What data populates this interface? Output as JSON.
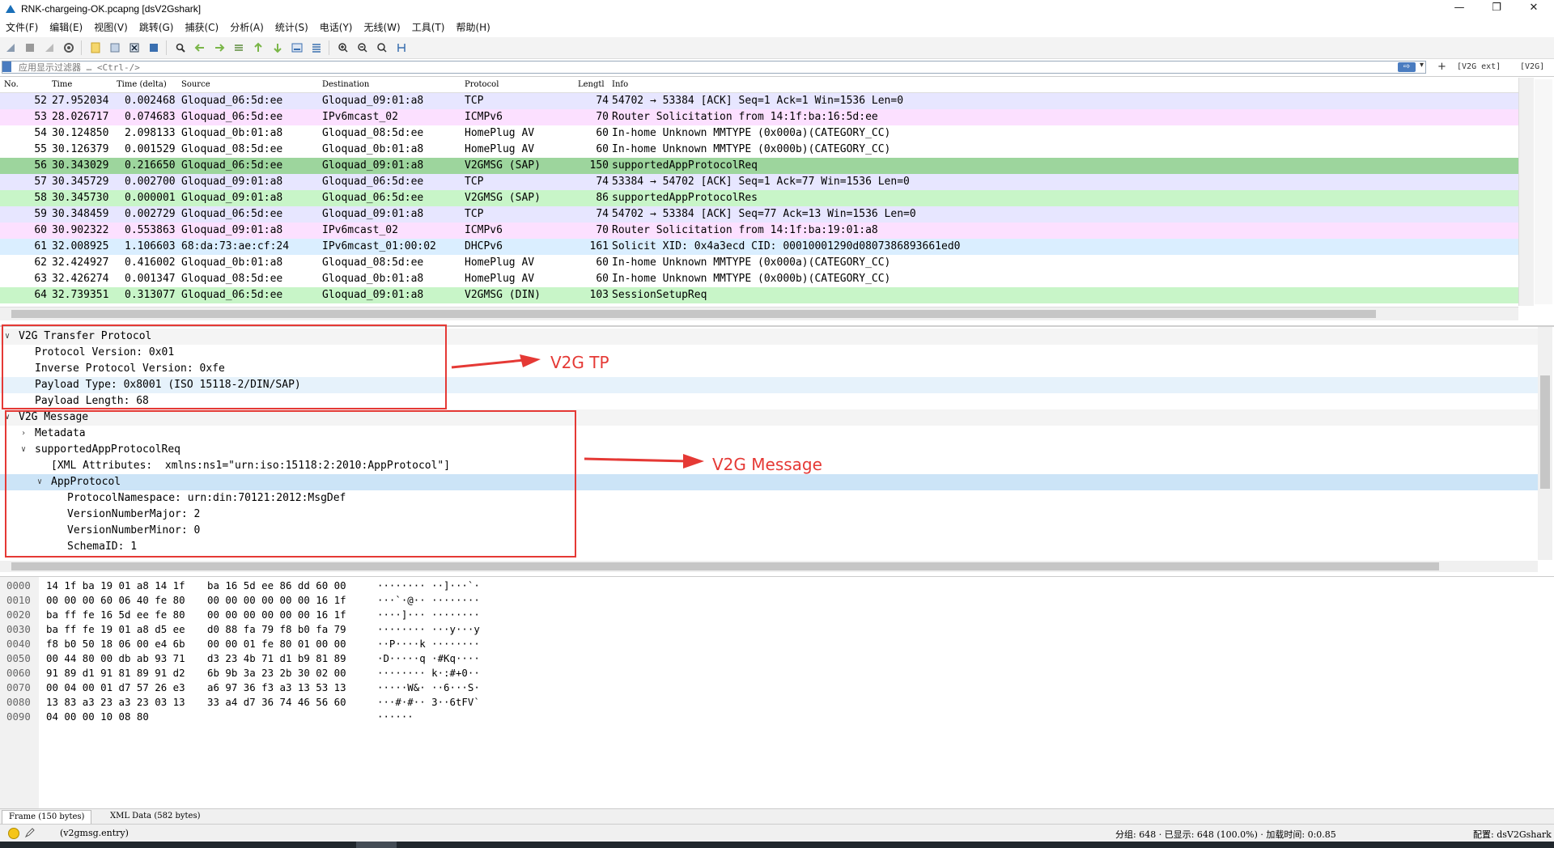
{
  "window": {
    "title": "RNK-chargeing-OK.pcapng [dsV2Gshark]",
    "controls": [
      "—",
      "❐",
      "✕"
    ]
  },
  "menu": [
    "文件(F)",
    "编辑(E)",
    "视图(V)",
    "跳转(G)",
    "捕获(C)",
    "分析(A)",
    "统计(S)",
    "电话(Y)",
    "无线(W)",
    "工具(T)",
    "帮助(H)"
  ],
  "filter": {
    "placeholder": "应用显示过滤器 … <Ctrl-/>",
    "buttons": [
      "V2G ext",
      "V2G"
    ]
  },
  "packet_list": {
    "columns": [
      "No.",
      "Time",
      "Time (delta)",
      "Source",
      "Destination",
      "Protocol",
      "Lengtl",
      "Info"
    ],
    "rows": [
      {
        "no": "52",
        "time": "27.952034",
        "delta": "0.002468",
        "src": "Gloquad_06:5d:ee",
        "dst": "Gloquad_09:01:a8",
        "proto": "TCP",
        "len": "74",
        "info": "54702 → 53384 [ACK] Seq=1 Ack=1 Win=1536 Len=0",
        "bg": "#e7e6ff"
      },
      {
        "no": "53",
        "time": "28.026717",
        "delta": "0.074683",
        "src": "Gloquad_06:5d:ee",
        "dst": "IPv6mcast_02",
        "proto": "ICMPv6",
        "len": "70",
        "info": "Router Solicitation from 14:1f:ba:16:5d:ee",
        "bg": "#fce0ff"
      },
      {
        "no": "54",
        "time": "30.124850",
        "delta": "2.098133",
        "src": "Gloquad_0b:01:a8",
        "dst": "Gloquad_08:5d:ee",
        "proto": "HomePlug AV",
        "len": "60",
        "info": "In-home Unknown MMTYPE (0x000a)(CATEGORY_CC)",
        "bg": "#ffffff"
      },
      {
        "no": "55",
        "time": "30.126379",
        "delta": "0.001529",
        "src": "Gloquad_08:5d:ee",
        "dst": "Gloquad_0b:01:a8",
        "proto": "HomePlug AV",
        "len": "60",
        "info": "In-home Unknown MMTYPE (0x000b)(CATEGORY_CC)",
        "bg": "#ffffff"
      },
      {
        "no": "56",
        "time": "30.343029",
        "delta": "0.216650",
        "src": "Gloquad_06:5d:ee",
        "dst": "Gloquad_09:01:a8",
        "proto": "V2GMSG (SAP)",
        "len": "150",
        "info": "supportedAppProtocolReq",
        "bg": "#9dd59d"
      },
      {
        "no": "57",
        "time": "30.345729",
        "delta": "0.002700",
        "src": "Gloquad_09:01:a8",
        "dst": "Gloquad_06:5d:ee",
        "proto": "TCP",
        "len": "74",
        "info": "53384 → 54702 [ACK] Seq=1 Ack=77 Win=1536 Len=0",
        "bg": "#e7e6ff"
      },
      {
        "no": "58",
        "time": "30.345730",
        "delta": "0.000001",
        "src": "Gloquad_09:01:a8",
        "dst": "Gloquad_06:5d:ee",
        "proto": "V2GMSG (SAP)",
        "len": "86",
        "info": "supportedAppProtocolRes",
        "bg": "#c8f5c8"
      },
      {
        "no": "59",
        "time": "30.348459",
        "delta": "0.002729",
        "src": "Gloquad_06:5d:ee",
        "dst": "Gloquad_09:01:a8",
        "proto": "TCP",
        "len": "74",
        "info": "54702 → 53384 [ACK] Seq=77 Ack=13 Win=1536 Len=0",
        "bg": "#e7e6ff"
      },
      {
        "no": "60",
        "time": "30.902322",
        "delta": "0.553863",
        "src": "Gloquad_09:01:a8",
        "dst": "IPv6mcast_02",
        "proto": "ICMPv6",
        "len": "70",
        "info": "Router Solicitation from 14:1f:ba:19:01:a8",
        "bg": "#fce0ff"
      },
      {
        "no": "61",
        "time": "32.008925",
        "delta": "1.106603",
        "src": "68:da:73:ae:cf:24",
        "dst": "IPv6mcast_01:00:02",
        "proto": "DHCPv6",
        "len": "161",
        "info": "Solicit XID: 0x4a3ecd CID: 00010001290d0807386893661ed0",
        "bg": "#daeeff"
      },
      {
        "no": "62",
        "time": "32.424927",
        "delta": "0.416002",
        "src": "Gloquad_0b:01:a8",
        "dst": "Gloquad_08:5d:ee",
        "proto": "HomePlug AV",
        "len": "60",
        "info": "In-home Unknown MMTYPE (0x000a)(CATEGORY_CC)",
        "bg": "#ffffff"
      },
      {
        "no": "63",
        "time": "32.426274",
        "delta": "0.001347",
        "src": "Gloquad_08:5d:ee",
        "dst": "Gloquad_0b:01:a8",
        "proto": "HomePlug AV",
        "len": "60",
        "info": "In-home Unknown MMTYPE (0x000b)(CATEGORY_CC)",
        "bg": "#ffffff"
      },
      {
        "no": "64",
        "time": "32.739351",
        "delta": "0.313077",
        "src": "Gloquad_06:5d:ee",
        "dst": "Gloquad_09:01:a8",
        "proto": "V2GMSG (DIN)",
        "len": "103",
        "info": "SessionSetupReq",
        "bg": "#c8f5c8"
      }
    ]
  },
  "detail_tree": [
    {
      "text": "V2G Transfer Protocol",
      "twisty": "open",
      "indent": 0,
      "bg": "#f4f4f4"
    },
    {
      "text": "Protocol Version: 0x01",
      "twisty": "",
      "indent": 2,
      "bg": "#ffffff"
    },
    {
      "text": "Inverse Protocol Version: 0xfe",
      "twisty": "",
      "indent": 2,
      "bg": "#ffffff"
    },
    {
      "text": "Payload Type: 0x8001 (ISO 15118-2/DIN/SAP)",
      "twisty": "",
      "indent": 2,
      "bg": "#e6f2fb"
    },
    {
      "text": "Payload Length: 68",
      "twisty": "",
      "indent": 2,
      "bg": "#ffffff"
    },
    {
      "text": "V2G Message",
      "twisty": "open",
      "indent": 0,
      "bg": "#f4f4f4"
    },
    {
      "text": "Metadata",
      "twisty": "closed",
      "indent": 2,
      "bg": "#ffffff"
    },
    {
      "text": "supportedAppProtocolReq",
      "twisty": "open",
      "indent": 2,
      "bg": "#ffffff"
    },
    {
      "text": "[XML Attributes:  xmlns:ns1=\"urn:iso:15118:2:2010:AppProtocol\"]",
      "twisty": "",
      "indent": 4,
      "bg": "#ffffff"
    },
    {
      "text": "AppProtocol",
      "twisty": "open",
      "indent": 4,
      "bg": "#cce4f7"
    },
    {
      "text": "ProtocolNamespace: urn:din:70121:2012:MsgDef",
      "twisty": "",
      "indent": 6,
      "bg": "#ffffff"
    },
    {
      "text": "VersionNumberMajor: 2",
      "twisty": "",
      "indent": 6,
      "bg": "#ffffff"
    },
    {
      "text": "VersionNumberMinor: 0",
      "twisty": "",
      "indent": 6,
      "bg": "#ffffff"
    },
    {
      "text": "SchemaID: 1",
      "twisty": "",
      "indent": 6,
      "bg": "#ffffff"
    }
  ],
  "annotations": [
    {
      "label": "V2G TP"
    },
    {
      "label": "V2G Message"
    }
  ],
  "bytes": [
    {
      "offset": "0000",
      "hex1": "14 1f ba 19 01 a8 14 1f",
      "hex2": "ba 16 5d ee 86 dd 60 00",
      "ascii": "········ ··]···`·"
    },
    {
      "offset": "0010",
      "hex1": "00 00 00 60 06 40 fe 80",
      "hex2": "00 00 00 00 00 00 16 1f",
      "ascii": "···`·@·· ········"
    },
    {
      "offset": "0020",
      "hex1": "ba ff fe 16 5d ee fe 80",
      "hex2": "00 00 00 00 00 00 16 1f",
      "ascii": "····]··· ········"
    },
    {
      "offset": "0030",
      "hex1": "ba ff fe 19 01 a8 d5 ee",
      "hex2": "d0 88 fa 79 f8 b0 fa 79",
      "ascii": "········ ···y···y"
    },
    {
      "offset": "0040",
      "hex1": "f8 b0 50 18 06 00 e4 6b",
      "hex2": "00 00 01 fe 80 01 00 00",
      "ascii": "··P····k ········"
    },
    {
      "offset": "0050",
      "hex1": "00 44 80 00 db ab 93 71",
      "hex2": "d3 23 4b 71 d1 b9 81 89",
      "ascii": "·D·····q ·#Kq····"
    },
    {
      "offset": "0060",
      "hex1": "91 89 d1 91 81 89 91 d2",
      "hex2": "6b 9b 3a 23 2b 30 02 00",
      "ascii": "········ k·:#+0··"
    },
    {
      "offset": "0070",
      "hex1": "00 04 00 01 d7 57 26 e3",
      "hex2": "a6 97 36 f3 a3 13 53 13",
      "ascii": "·····W&· ··6···S·"
    },
    {
      "offset": "0080",
      "hex1": "13 83 a3 23 a3 23 03 13",
      "hex2": "33 a4 d7 36 74 46 56 60",
      "ascii": "···#·#·· 3··6tFV`"
    },
    {
      "offset": "0090",
      "hex1": "04 00 00 10 08 80",
      "hex2": "",
      "ascii": "······"
    }
  ],
  "byte_tabs": [
    "Frame (150 bytes)",
    "XML Data (582 bytes)"
  ],
  "status": {
    "field": "(v2gmsg.entry)",
    "packets": "分组: 648 · 已显示: 648 (100.0%) · 加载时间: 0:0.85",
    "profile": "配置: dsV2Gshark"
  },
  "colors": {
    "annotation": "#e53935",
    "selected_row": "#9dd59d"
  }
}
